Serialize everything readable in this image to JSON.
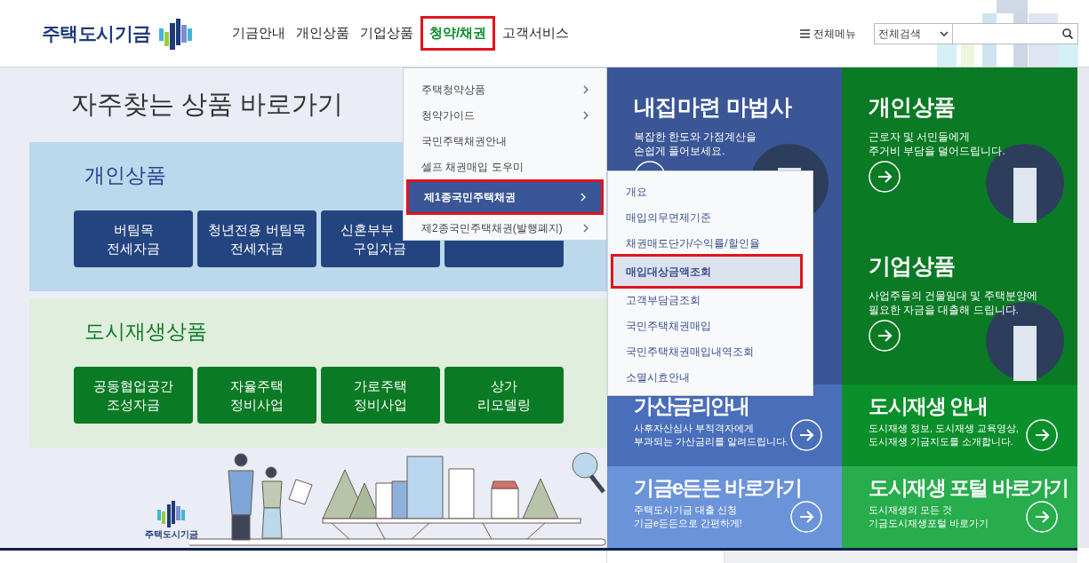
{
  "header": {
    "logo_text": "주택도시기금",
    "nav": [
      {
        "label": "기금안내",
        "selected": false
      },
      {
        "label": "개인상품",
        "selected": false
      },
      {
        "label": "기업상품",
        "selected": false
      },
      {
        "label": "청약/채권",
        "selected": true
      },
      {
        "label": "고객서비스",
        "selected": false
      }
    ],
    "all_menu": "전체메뉴",
    "search_scope": "전체검색"
  },
  "shortcuts": {
    "title": "자주찾는 상품 바로가기",
    "groups": [
      {
        "kind": "personal",
        "title": "개인상품",
        "buttons": [
          {
            "kind": "full",
            "lines": [
              "버팀목",
              "전세자금"
            ]
          },
          {
            "kind": "full",
            "lines": [
              "청년전용 버팀목",
              "전세자금"
            ]
          },
          {
            "kind": "cut",
            "lines": [
              "신혼부부",
              "구입자금"
            ]
          },
          {
            "kind": "covered"
          }
        ]
      },
      {
        "kind": "urban",
        "title": "도시재생상품",
        "buttons": [
          {
            "kind": "full",
            "lines": [
              "공동협업공간",
              "조성자금"
            ]
          },
          {
            "kind": "full",
            "lines": [
              "자율주택",
              "정비사업"
            ]
          },
          {
            "kind": "full",
            "lines": [
              "가로주택",
              "정비사업"
            ]
          },
          {
            "kind": "full",
            "lines": [
              "상가",
              "리모델링"
            ]
          }
        ]
      }
    ],
    "illustration_logo_text": "주택도시기금"
  },
  "tiles": [
    {
      "kind": "big",
      "color": "#3a5696",
      "title": "내집마련 마법사",
      "desc": [
        "복잡한 한도와 가점계산을",
        "손쉽게 풀어보세요."
      ]
    },
    {
      "kind": "big",
      "color": "#0a7a24",
      "title": "개인상품",
      "desc": [
        "근로자 및 서민들에게",
        "주거비 부담을 덜어드립니다."
      ]
    },
    {
      "kind": "hidden",
      "color": "#3a5696"
    },
    {
      "kind": "big",
      "color": "#0a7a24",
      "title": "기업상품",
      "desc": [
        "사업주들의 건물임대 및 주택분양에",
        "필요한 자금을 대출해 드립니다."
      ]
    },
    {
      "kind": "small",
      "color": "#4a6fba",
      "title": "가산금리안내",
      "desc": [
        "사후자산심사 부적격자에게",
        "부과되는 가산금리를 알려드립니다."
      ]
    },
    {
      "kind": "small",
      "color": "#0a8f2a",
      "title": "도시재생 안내",
      "desc": [
        "도시재생 정보, 도시재생 교육영상,",
        "도시재생 기금지도를 소개합니다."
      ]
    },
    {
      "kind": "small",
      "color": "#6b93d9",
      "title": "기금e든든 바로가기",
      "desc": [
        "주택도시기금 대출 신청",
        "기금e든든으로 간편하게!"
      ]
    },
    {
      "kind": "small",
      "color": "#27ad4c",
      "title": "도시재생 포털 바로가기",
      "desc": [
        "도시재생의 모든 것",
        "기금도시재생포털 바로가기"
      ]
    }
  ],
  "dropdown": {
    "items": [
      {
        "label": "주택청약상품",
        "has_submenu": true,
        "selected": false
      },
      {
        "label": "청약가이드",
        "has_submenu": true,
        "selected": false
      },
      {
        "label": "국민주택채권안내",
        "has_submenu": false,
        "selected": false
      },
      {
        "label": "셀프 채권매입 도우미",
        "has_submenu": false,
        "selected": false
      },
      {
        "label": "제1종국민주택채권",
        "has_submenu": true,
        "selected": true
      },
      {
        "label": "제2종국민주택채권(발행폐지)",
        "has_submenu": true,
        "selected": false
      }
    ],
    "submenu": [
      {
        "label": "개요",
        "selected": false
      },
      {
        "label": "매입의무면제기준",
        "selected": false
      },
      {
        "label": "채권매도단가/수익률/할인율",
        "selected": false
      },
      {
        "label": "매입대상금액조회",
        "selected": true
      },
      {
        "label": "고객부담금조회",
        "selected": false
      },
      {
        "label": "국민주택채권매입",
        "selected": false
      },
      {
        "label": "국민주택채권매입내역조회",
        "selected": false
      },
      {
        "label": "소멸시효안내",
        "selected": false
      }
    ]
  }
}
